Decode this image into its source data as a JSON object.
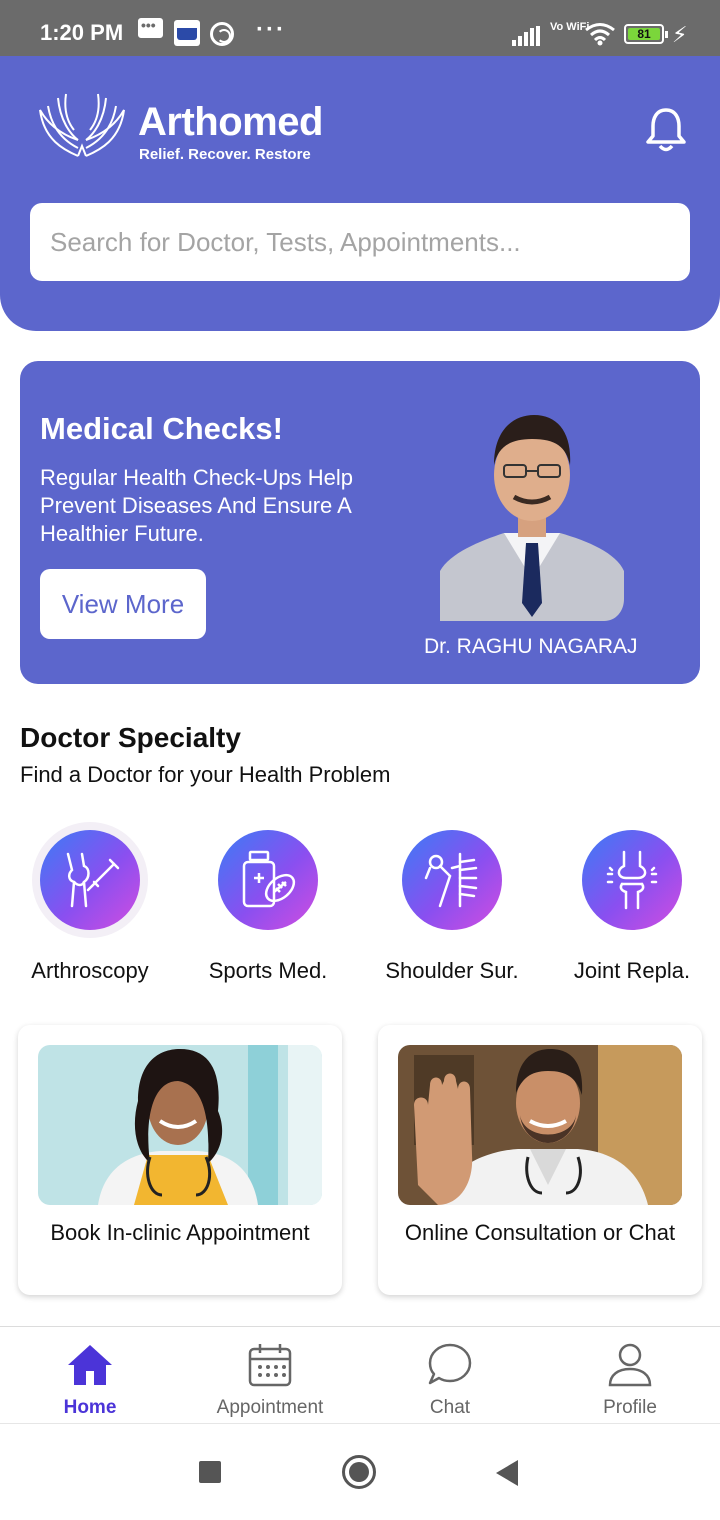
{
  "status_bar": {
    "time": "1:20 PM",
    "battery": "81",
    "network_label": "Vo WiFi",
    "icons": [
      "message-icon",
      "amazon-icon",
      "target-icon",
      "more-dots-icon",
      "signal-icon",
      "vowifi-icon",
      "wifi-icon",
      "battery-icon",
      "charging-icon"
    ]
  },
  "header": {
    "brand_name": "Arthomed",
    "tagline": "Relief. Recover. Restore",
    "search_placeholder": "Search for Doctor, Tests, Appointments..."
  },
  "banner": {
    "title": "Medical Checks!",
    "text": "Regular Health Check-Ups Help Prevent Diseases And Ensure A Healthier Future.",
    "button_label": "View More",
    "doctor_name": "Dr. RAGHU NAGARAJ"
  },
  "specialty": {
    "title": "Doctor Specialty",
    "subtitle": "Find a Doctor for your Health Problem",
    "items": [
      {
        "label": "Arthroscopy",
        "icon": "knee-injection-icon"
      },
      {
        "label": "Sports Med.",
        "icon": "medicine-football-icon"
      },
      {
        "label": "Shoulder Sur.",
        "icon": "shoulder-bone-icon"
      },
      {
        "label": "Joint Repla.",
        "icon": "knee-joint-icon"
      }
    ]
  },
  "cards": [
    {
      "caption": "Book In-clinic Appointment"
    },
    {
      "caption": "Online Consultation or Chat"
    }
  ],
  "bottom_nav": {
    "items": [
      {
        "label": "Home",
        "icon": "home-icon",
        "active": true
      },
      {
        "label": "Appointment",
        "icon": "calendar-icon",
        "active": false
      },
      {
        "label": "Chat",
        "icon": "chat-icon",
        "active": false
      },
      {
        "label": "Profile",
        "icon": "profile-icon",
        "active": false
      }
    ]
  },
  "colors": {
    "primary": "#5c66cc",
    "nav_active": "#4b34d8",
    "status_bar": "#6b6b6b"
  }
}
